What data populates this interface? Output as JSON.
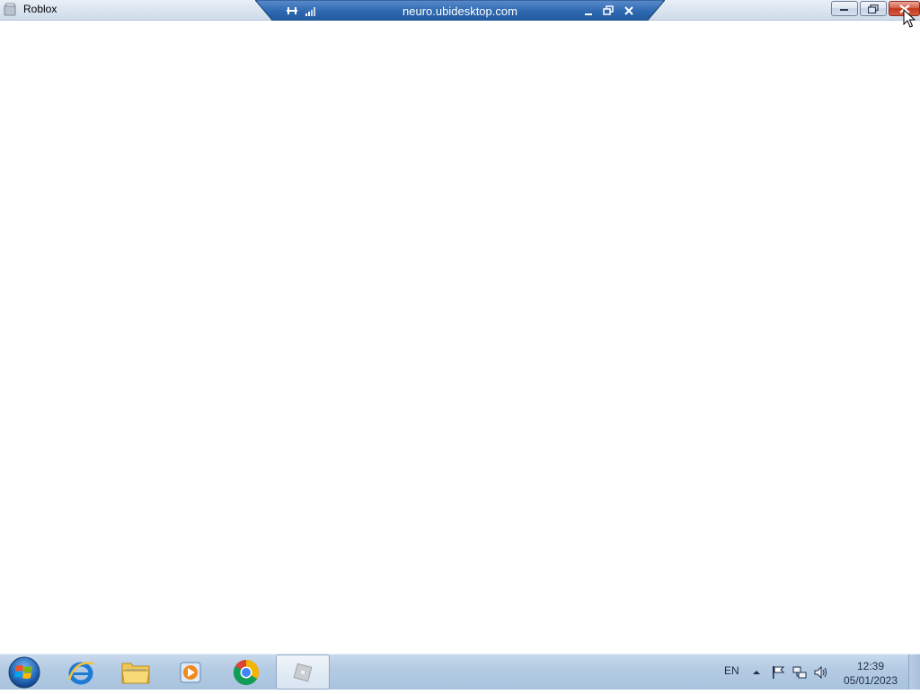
{
  "window": {
    "title": "Roblox",
    "icon": "roblox-app-icon",
    "controls": [
      "minimize-icon",
      "restore-icon",
      "close-icon"
    ]
  },
  "remote_bar": {
    "host": "neuro.ubidesktop.com",
    "icons": [
      "pin-icon",
      "signal-icon",
      "minimize-icon",
      "restore-icon",
      "close-icon"
    ]
  },
  "taskbar": {
    "start": "windows-start-orb",
    "pinned": [
      {
        "name": "internet-explorer",
        "icon": "ie-icon"
      },
      {
        "name": "file-explorer",
        "icon": "folder-icon"
      },
      {
        "name": "media-player",
        "icon": "media-player-icon"
      },
      {
        "name": "chrome",
        "icon": "chrome-icon"
      },
      {
        "name": "roblox",
        "icon": "roblox-icon",
        "active": true
      }
    ],
    "tray": {
      "language": "EN",
      "icons": [
        "show-hidden-icons-icon",
        "action-center-flag-icon",
        "network-icon",
        "volume-icon"
      ],
      "time": "12:39",
      "date": "05/01/2023"
    }
  },
  "colors": {
    "remote_bar": "#2d68b0",
    "close_button": "#c7422a",
    "taskbar": "#b4cbe3"
  }
}
